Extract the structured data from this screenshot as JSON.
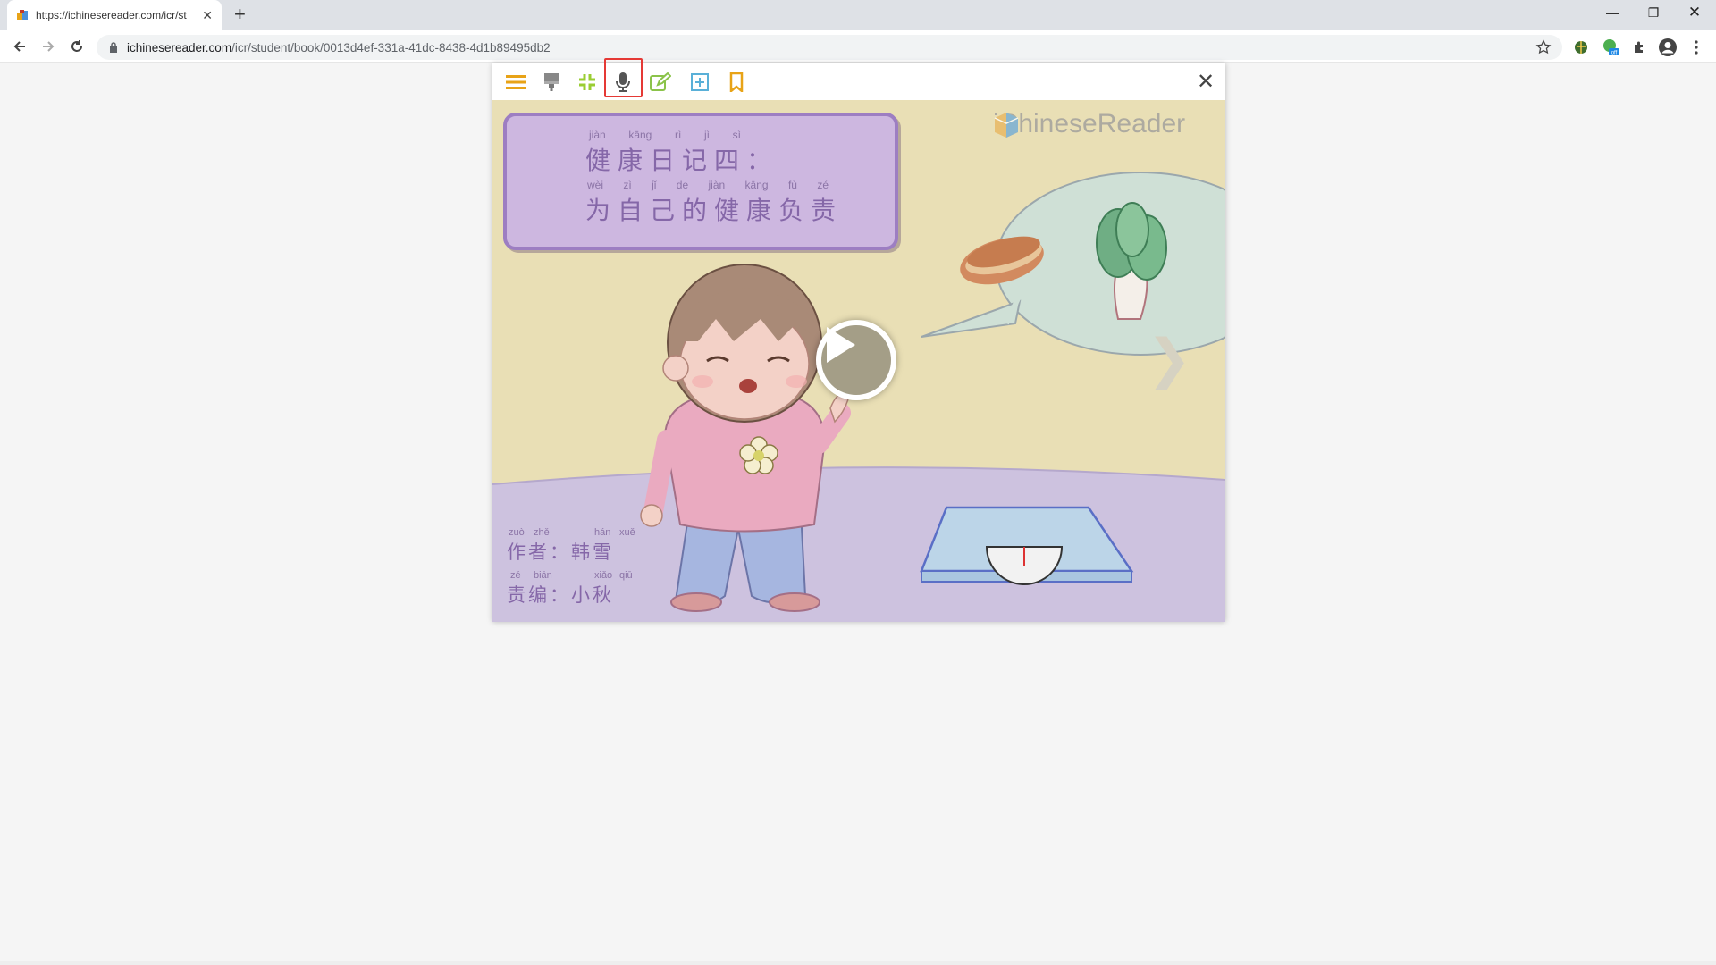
{
  "browser": {
    "tab_title": "https://ichinesereader.com/icr/st",
    "url_host": "ichinesereader.com",
    "url_path": "/icr/student/book/0013d4ef-331a-41dc-8438-4d1b89495db2"
  },
  "reader": {
    "toolbar_icons": [
      "menu-icon",
      "highlighter-icon",
      "shrink-icon",
      "microphone-icon",
      "edit-icon",
      "add-icon",
      "bookmark-icon"
    ],
    "title_pinyin_1": [
      "jiàn",
      "kāng",
      "rì",
      "jì",
      "sì"
    ],
    "title_hanzi_1": "健康日记四：",
    "title_pinyin_2": [
      "wèi",
      "zì",
      "jǐ",
      "de",
      "jiàn",
      "kāng",
      "fù",
      "zé"
    ],
    "title_hanzi_2": "为自己的健康负责",
    "author_pinyin": [
      "zuò",
      "zhě",
      "hán",
      "xuě"
    ],
    "author_hanzi": "作者：韩雪",
    "editor_pinyin": [
      "zé",
      "biān",
      "xiǎo",
      "qiū"
    ],
    "editor_hanzi": "责编：小秋",
    "logo_text": "iChineseReader",
    "colors": {
      "accent_orange": "#e8a317",
      "mic_highlight": "#e53935",
      "title_purple": "#8567a8"
    }
  }
}
